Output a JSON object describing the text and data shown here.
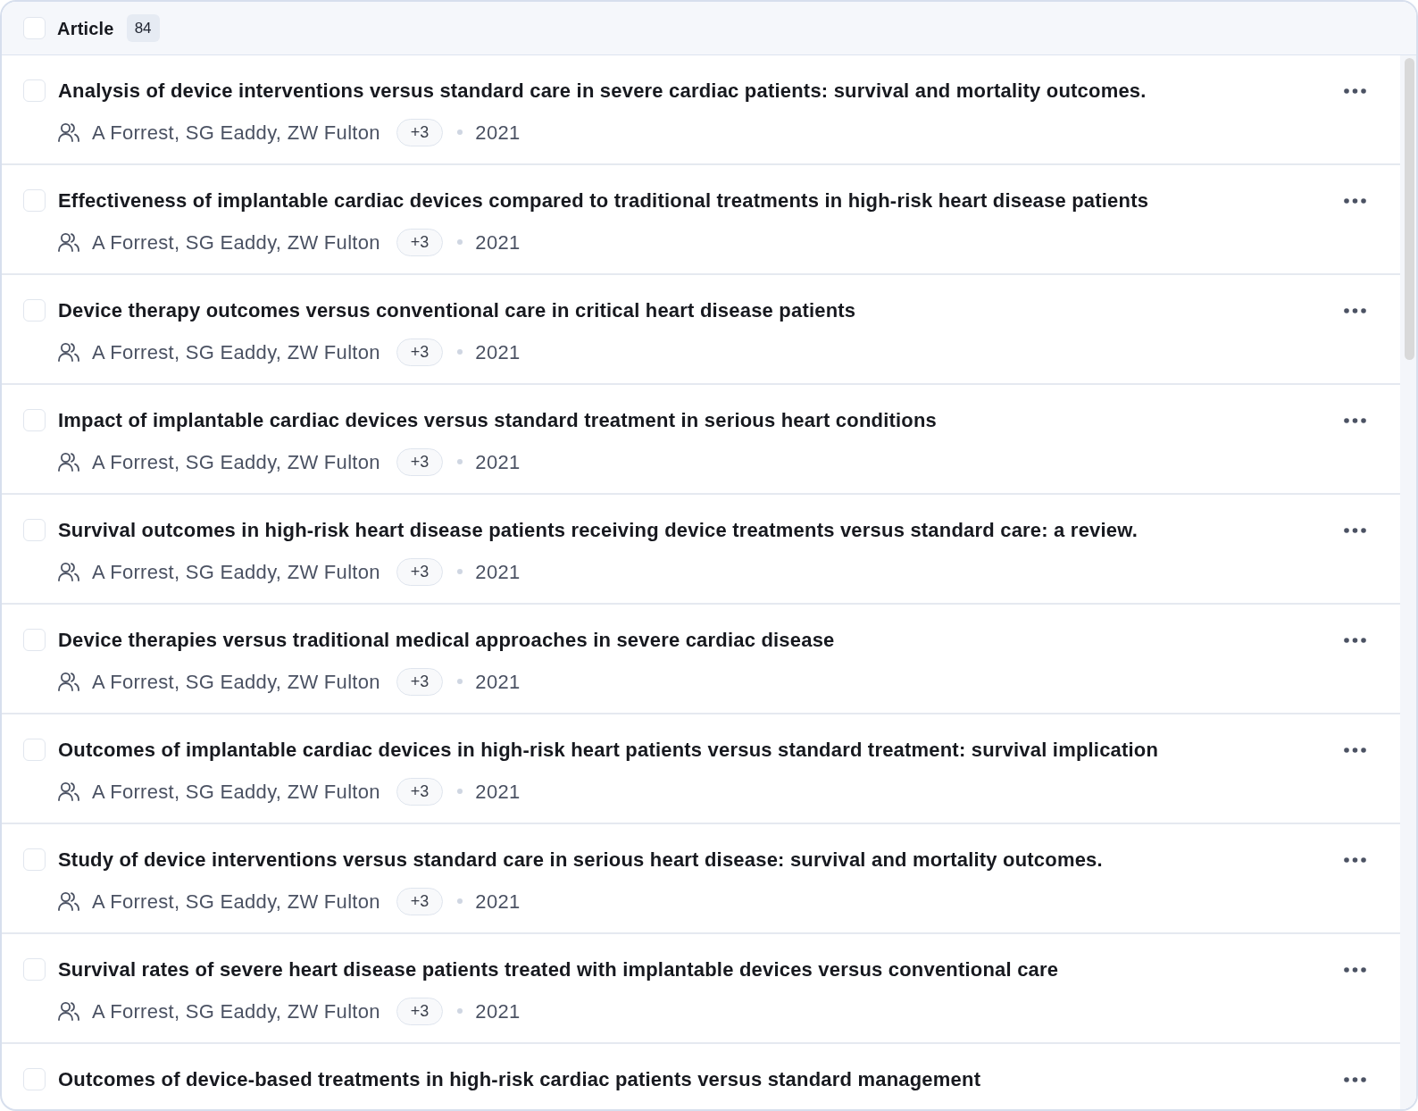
{
  "header": {
    "checked": false,
    "label": "Article",
    "count": "84"
  },
  "articles": [
    {
      "checked": false,
      "title": "Analysis of device interventions versus standard care in severe cardiac patients: survival and mortality outcomes.",
      "authors": "A Forrest, SG Eaddy, ZW Fulton",
      "more_authors": "+3",
      "year": "2021"
    },
    {
      "checked": false,
      "title": "Effectiveness of implantable cardiac devices compared to traditional treatments in high-risk heart disease patients",
      "authors": "A Forrest, SG Eaddy, ZW Fulton",
      "more_authors": "+3",
      "year": "2021"
    },
    {
      "checked": false,
      "title": "Device therapy outcomes versus conventional care in critical heart disease patients",
      "authors": "A Forrest, SG Eaddy, ZW Fulton",
      "more_authors": "+3",
      "year": "2021"
    },
    {
      "checked": false,
      "title": "Impact of implantable cardiac devices versus standard treatment in serious heart conditions",
      "authors": "A Forrest, SG Eaddy, ZW Fulton",
      "more_authors": "+3",
      "year": "2021"
    },
    {
      "checked": false,
      "title": "Survival outcomes in high-risk heart disease patients receiving device treatments versus standard care: a review.",
      "authors": "A Forrest, SG Eaddy, ZW Fulton",
      "more_authors": "+3",
      "year": "2021"
    },
    {
      "checked": false,
      "title": "Device therapies versus traditional medical approaches in severe cardiac disease",
      "authors": "A Forrest, SG Eaddy, ZW Fulton",
      "more_authors": "+3",
      "year": "2021"
    },
    {
      "checked": false,
      "title": "Outcomes of implantable cardiac devices in high-risk heart patients versus standard treatment: survival implication",
      "authors": "A Forrest, SG Eaddy, ZW Fulton",
      "more_authors": "+3",
      "year": "2021"
    },
    {
      "checked": false,
      "title": "Study of device interventions versus standard care in serious heart disease: survival and mortality outcomes.",
      "authors": "A Forrest, SG Eaddy, ZW Fulton",
      "more_authors": "+3",
      "year": "2021"
    },
    {
      "checked": false,
      "title": "Survival rates of severe heart disease patients treated with implantable devices versus conventional care",
      "authors": "A Forrest, SG Eaddy, ZW Fulton",
      "more_authors": "+3",
      "year": "2021"
    },
    {
      "checked": false,
      "title": "Outcomes of device-based treatments in high-risk cardiac patients versus standard management"
    }
  ]
}
